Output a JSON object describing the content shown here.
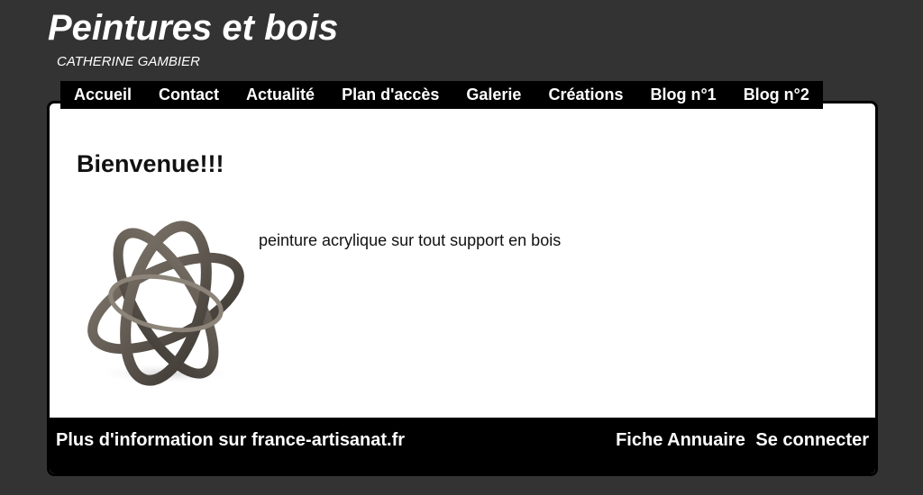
{
  "header": {
    "title": "Peintures et bois",
    "subtitle": "CATHERINE GAMBIER"
  },
  "nav": {
    "items": [
      {
        "label": "Accueil"
      },
      {
        "label": "Contact"
      },
      {
        "label": "Actualité"
      },
      {
        "label": "Plan d'accès"
      },
      {
        "label": "Galerie"
      },
      {
        "label": "Créations"
      },
      {
        "label": "Blog n°1"
      },
      {
        "label": "Blog n°2"
      }
    ]
  },
  "main": {
    "heading": "Bienvenue!!!",
    "description": "peinture acrylique sur tout support en bois"
  },
  "footer": {
    "info_prefix": "Plus d'information sur",
    "info_link": "france-artisanat.fr",
    "annuaire_link": "Fiche Annuaire",
    "login_link": "Se connecter"
  },
  "colors": {
    "page_background": "#333333",
    "nav_background": "#000000",
    "content_background": "#ffffff"
  }
}
